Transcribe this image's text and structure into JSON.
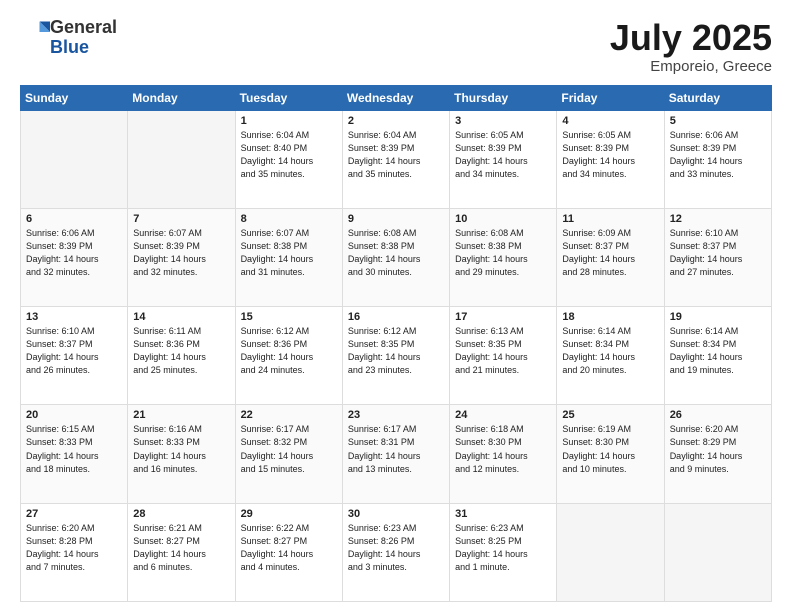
{
  "header": {
    "logo_general": "General",
    "logo_blue": "Blue",
    "title": "July 2025",
    "location": "Emporeio, Greece"
  },
  "days_of_week": [
    "Sunday",
    "Monday",
    "Tuesday",
    "Wednesday",
    "Thursday",
    "Friday",
    "Saturday"
  ],
  "weeks": [
    [
      {
        "day": "",
        "info": ""
      },
      {
        "day": "",
        "info": ""
      },
      {
        "day": "1",
        "info": "Sunrise: 6:04 AM\nSunset: 8:40 PM\nDaylight: 14 hours\nand 35 minutes."
      },
      {
        "day": "2",
        "info": "Sunrise: 6:04 AM\nSunset: 8:39 PM\nDaylight: 14 hours\nand 35 minutes."
      },
      {
        "day": "3",
        "info": "Sunrise: 6:05 AM\nSunset: 8:39 PM\nDaylight: 14 hours\nand 34 minutes."
      },
      {
        "day": "4",
        "info": "Sunrise: 6:05 AM\nSunset: 8:39 PM\nDaylight: 14 hours\nand 34 minutes."
      },
      {
        "day": "5",
        "info": "Sunrise: 6:06 AM\nSunset: 8:39 PM\nDaylight: 14 hours\nand 33 minutes."
      }
    ],
    [
      {
        "day": "6",
        "info": "Sunrise: 6:06 AM\nSunset: 8:39 PM\nDaylight: 14 hours\nand 32 minutes."
      },
      {
        "day": "7",
        "info": "Sunrise: 6:07 AM\nSunset: 8:39 PM\nDaylight: 14 hours\nand 32 minutes."
      },
      {
        "day": "8",
        "info": "Sunrise: 6:07 AM\nSunset: 8:38 PM\nDaylight: 14 hours\nand 31 minutes."
      },
      {
        "day": "9",
        "info": "Sunrise: 6:08 AM\nSunset: 8:38 PM\nDaylight: 14 hours\nand 30 minutes."
      },
      {
        "day": "10",
        "info": "Sunrise: 6:08 AM\nSunset: 8:38 PM\nDaylight: 14 hours\nand 29 minutes."
      },
      {
        "day": "11",
        "info": "Sunrise: 6:09 AM\nSunset: 8:37 PM\nDaylight: 14 hours\nand 28 minutes."
      },
      {
        "day": "12",
        "info": "Sunrise: 6:10 AM\nSunset: 8:37 PM\nDaylight: 14 hours\nand 27 minutes."
      }
    ],
    [
      {
        "day": "13",
        "info": "Sunrise: 6:10 AM\nSunset: 8:37 PM\nDaylight: 14 hours\nand 26 minutes."
      },
      {
        "day": "14",
        "info": "Sunrise: 6:11 AM\nSunset: 8:36 PM\nDaylight: 14 hours\nand 25 minutes."
      },
      {
        "day": "15",
        "info": "Sunrise: 6:12 AM\nSunset: 8:36 PM\nDaylight: 14 hours\nand 24 minutes."
      },
      {
        "day": "16",
        "info": "Sunrise: 6:12 AM\nSunset: 8:35 PM\nDaylight: 14 hours\nand 23 minutes."
      },
      {
        "day": "17",
        "info": "Sunrise: 6:13 AM\nSunset: 8:35 PM\nDaylight: 14 hours\nand 21 minutes."
      },
      {
        "day": "18",
        "info": "Sunrise: 6:14 AM\nSunset: 8:34 PM\nDaylight: 14 hours\nand 20 minutes."
      },
      {
        "day": "19",
        "info": "Sunrise: 6:14 AM\nSunset: 8:34 PM\nDaylight: 14 hours\nand 19 minutes."
      }
    ],
    [
      {
        "day": "20",
        "info": "Sunrise: 6:15 AM\nSunset: 8:33 PM\nDaylight: 14 hours\nand 18 minutes."
      },
      {
        "day": "21",
        "info": "Sunrise: 6:16 AM\nSunset: 8:33 PM\nDaylight: 14 hours\nand 16 minutes."
      },
      {
        "day": "22",
        "info": "Sunrise: 6:17 AM\nSunset: 8:32 PM\nDaylight: 14 hours\nand 15 minutes."
      },
      {
        "day": "23",
        "info": "Sunrise: 6:17 AM\nSunset: 8:31 PM\nDaylight: 14 hours\nand 13 minutes."
      },
      {
        "day": "24",
        "info": "Sunrise: 6:18 AM\nSunset: 8:30 PM\nDaylight: 14 hours\nand 12 minutes."
      },
      {
        "day": "25",
        "info": "Sunrise: 6:19 AM\nSunset: 8:30 PM\nDaylight: 14 hours\nand 10 minutes."
      },
      {
        "day": "26",
        "info": "Sunrise: 6:20 AM\nSunset: 8:29 PM\nDaylight: 14 hours\nand 9 minutes."
      }
    ],
    [
      {
        "day": "27",
        "info": "Sunrise: 6:20 AM\nSunset: 8:28 PM\nDaylight: 14 hours\nand 7 minutes."
      },
      {
        "day": "28",
        "info": "Sunrise: 6:21 AM\nSunset: 8:27 PM\nDaylight: 14 hours\nand 6 minutes."
      },
      {
        "day": "29",
        "info": "Sunrise: 6:22 AM\nSunset: 8:27 PM\nDaylight: 14 hours\nand 4 minutes."
      },
      {
        "day": "30",
        "info": "Sunrise: 6:23 AM\nSunset: 8:26 PM\nDaylight: 14 hours\nand 3 minutes."
      },
      {
        "day": "31",
        "info": "Sunrise: 6:23 AM\nSunset: 8:25 PM\nDaylight: 14 hours\nand 1 minute."
      },
      {
        "day": "",
        "info": ""
      },
      {
        "day": "",
        "info": ""
      }
    ]
  ]
}
